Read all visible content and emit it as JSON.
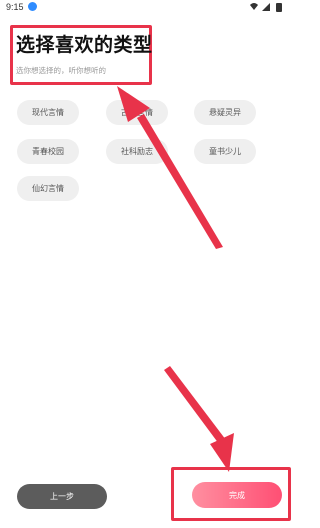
{
  "status_bar": {
    "time": "9:15"
  },
  "header": {
    "title": "选择喜欢的类型",
    "subtitle": "选你想选择的，听你想听的"
  },
  "categories": [
    "现代言情",
    "古代言情",
    "悬疑灵异",
    "青春校园",
    "社科励志",
    "童书少儿",
    "仙幻言情"
  ],
  "footer": {
    "prev_label": "上一步",
    "done_label": "完成"
  },
  "colors": {
    "annotation": "#e8334a",
    "done_button_start": "#ff8fa0",
    "done_button_end": "#ff4f74",
    "prev_button": "#5c5c5c",
    "chip_bg": "#efefef"
  }
}
